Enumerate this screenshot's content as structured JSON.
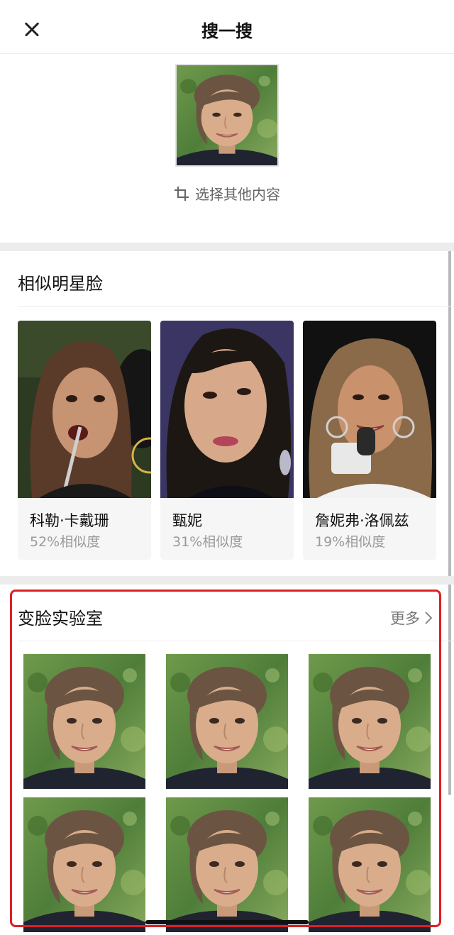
{
  "header": {
    "title": "搜一搜",
    "close_icon": "close-icon"
  },
  "query": {
    "select_other_label": "选择其他内容",
    "crop_icon": "crop-icon"
  },
  "similar_stars": {
    "title": "相似明星脸",
    "cards": [
      {
        "name": "科勒·卡戴珊",
        "similarity": "52%相似度"
      },
      {
        "name": "甄妮",
        "similarity": "31%相似度"
      },
      {
        "name": "詹妮弗·洛佩兹",
        "similarity": "19%相似度"
      }
    ]
  },
  "face_lab": {
    "title": "变脸实验室",
    "more_label": "更多",
    "highlight_color": "#dd1f26"
  }
}
